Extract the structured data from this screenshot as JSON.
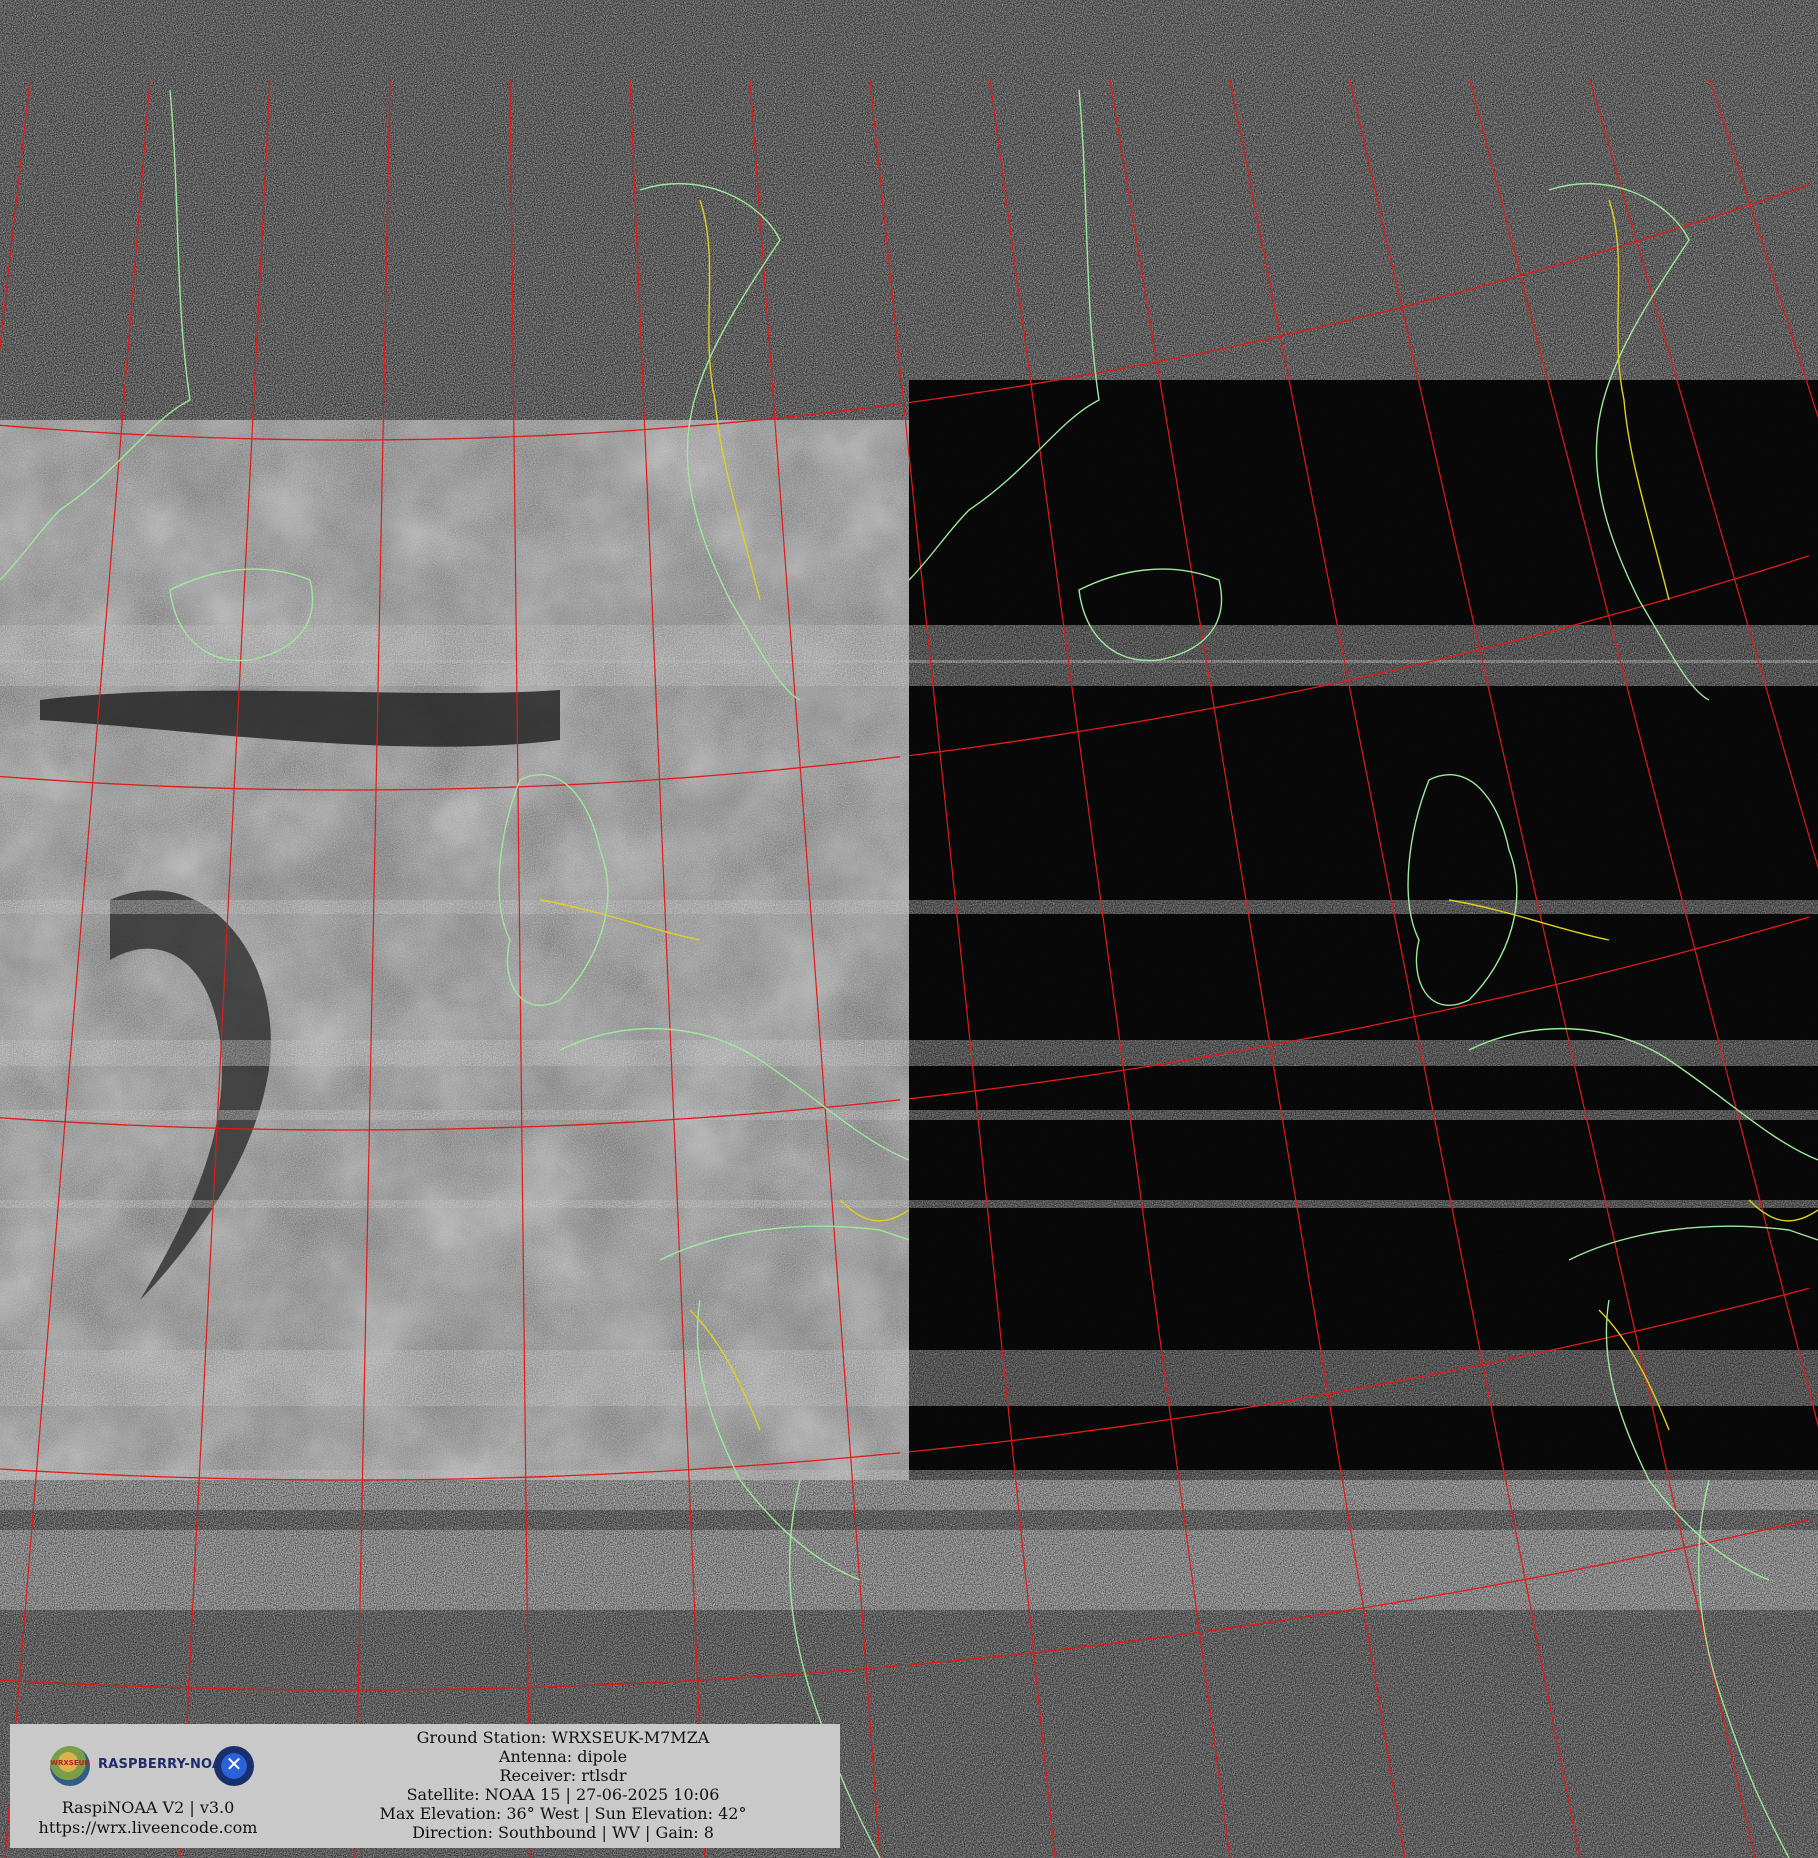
{
  "image": {
    "description_panels": [
      "visible-channel",
      "infrared-channel"
    ],
    "graticule_color": "#e11a1a",
    "coastline_color": "#9ee89b",
    "border_color": "#e0d020"
  },
  "info_box": {
    "logo_mark_text": "WRXSEUK",
    "logo_brand_text": "RASPBERRY-NOAA",
    "logo_badge_text": "✕",
    "software": "RaspiNOAA V2 | v3.0",
    "website": "https://wrx.liveencode.com",
    "lines": [
      "Ground Station: WRXSEUK-M7MZA",
      "Antenna: dipole",
      "Receiver: rtlsdr",
      "Satellite: NOAA 15 | 27-06-2025 10:06",
      "Max Elevation: 36° West | Sun Elevation: 42°",
      "Direction: Southbound | WV | Gain: 8"
    ]
  }
}
